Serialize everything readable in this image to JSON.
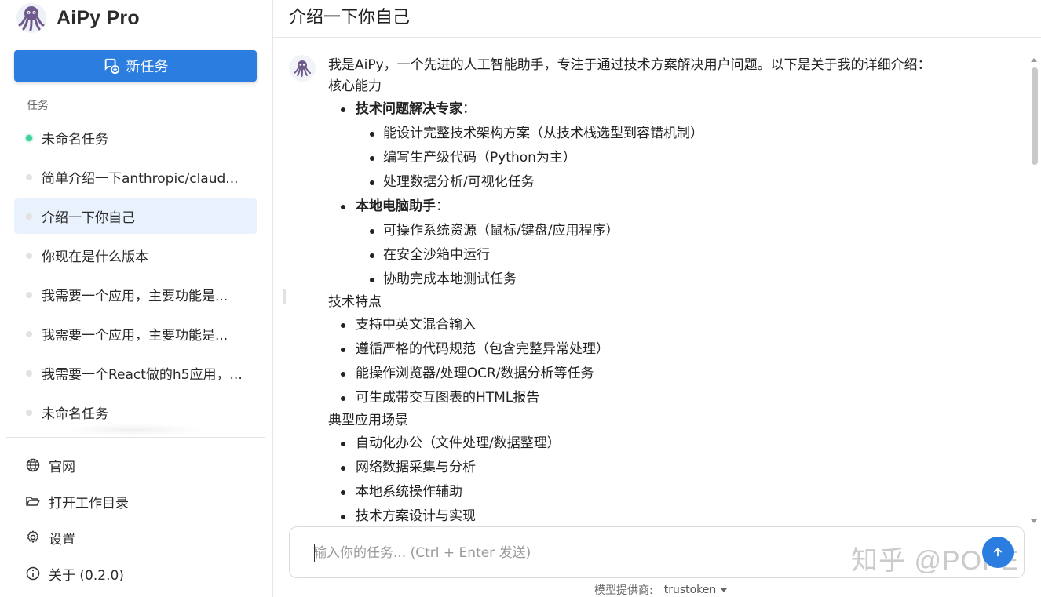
{
  "app": {
    "name": "AiPy Pro"
  },
  "sidebar": {
    "new_task_label": "新任务",
    "section_label": "任务",
    "tasks": [
      {
        "label": "未命名任务",
        "status": "live",
        "active": false
      },
      {
        "label": "简单介绍一下anthropic/claud...",
        "status": "idle",
        "active": false
      },
      {
        "label": "介绍一下你自己",
        "status": "idle",
        "active": true
      },
      {
        "label": "你现在是什么版本",
        "status": "idle",
        "active": false
      },
      {
        "label": "我需要一个应用，主要功能是...",
        "status": "idle",
        "active": false
      },
      {
        "label": "我需要一个应用，主要功能是...",
        "status": "idle",
        "active": false
      },
      {
        "label": "我需要一个React做的h5应用，...",
        "status": "idle",
        "active": false
      },
      {
        "label": "未命名任务",
        "status": "idle",
        "active": false
      }
    ],
    "footer": {
      "website": "官网",
      "open_workdir": "打开工作目录",
      "settings": "设置",
      "about": "关于 (0.2.0)"
    }
  },
  "header": {
    "title": "介绍一下你自己"
  },
  "message": {
    "intro": "我是AiPy，一个先进的人工智能助手，专注于通过技术方案解决用户问题。以下是关于我的详细介绍：",
    "sections": [
      {
        "heading": "核心能力",
        "items": [
          {
            "bold": "技术问题解决专家",
            "suffix": "：",
            "subitems": [
              "能设计完整技术架构方案（从技术栈选型到容错机制）",
              "编写生产级代码（Python为主）",
              "处理数据分析/可视化任务"
            ]
          },
          {
            "bold": "本地电脑助手",
            "suffix": "：",
            "subitems": [
              "可操作系统资源（鼠标/键盘/应用程序）",
              "在安全沙箱中运行",
              "协助完成本地测试任务"
            ]
          }
        ]
      },
      {
        "heading": "技术特点",
        "items": [
          "支持中英文混合输入",
          "遵循严格的代码规范（包含完整异常处理）",
          "能操作浏览器/处理OCR/数据分析等任务",
          "可生成带交互图表的HTML报告"
        ]
      },
      {
        "heading": "典型应用场景",
        "items": [
          "自动化办公（文件处理/数据整理）",
          "网络数据采集与分析",
          "本地系统操作辅助",
          "技术方案设计与实现"
        ]
      }
    ]
  },
  "input": {
    "placeholder": "输入你的任务... (Ctrl + Enter 发送)",
    "value": ""
  },
  "provider": {
    "label": "模型提供商:",
    "value": "trustoken"
  },
  "watermark": "知乎 @POPE",
  "colors": {
    "accent": "#2b7de0",
    "active_bg": "#e8f1fc",
    "live_dot": "#3ed19a"
  }
}
